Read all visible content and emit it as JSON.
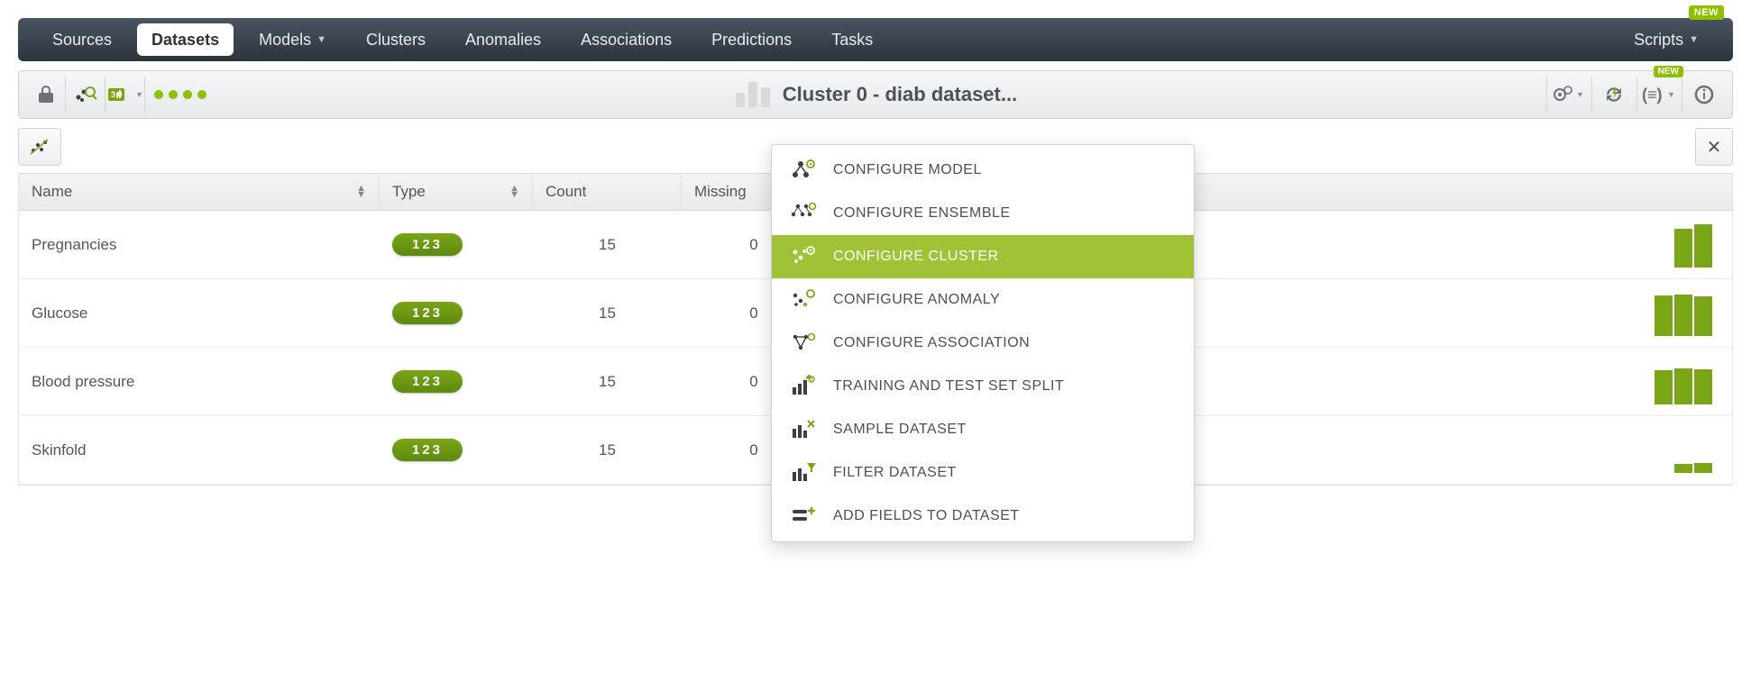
{
  "topnav": {
    "items": [
      {
        "label": "Sources",
        "active": false
      },
      {
        "label": "Datasets",
        "active": true
      },
      {
        "label": "Models",
        "active": false,
        "dropdown": true
      },
      {
        "label": "Clusters",
        "active": false
      },
      {
        "label": "Anomalies",
        "active": false
      },
      {
        "label": "Associations",
        "active": false
      },
      {
        "label": "Predictions",
        "active": false
      },
      {
        "label": "Tasks",
        "active": false
      }
    ],
    "scripts_label": "Scripts",
    "new_label": "NEW"
  },
  "subtoolbar": {
    "title": "Cluster 0 - diab dataset...",
    "new_label": "NEW"
  },
  "columns": {
    "name": "Name",
    "type": "Type",
    "count": "Count",
    "missing": "Missing"
  },
  "rows": [
    {
      "name": "Pregnancies",
      "type": "123",
      "count": "15",
      "missing": "0",
      "hist": [
        85,
        95
      ]
    },
    {
      "name": "Glucose",
      "type": "123",
      "count": "15",
      "missing": "0",
      "hist": [
        90,
        92,
        88
      ]
    },
    {
      "name": "Blood pressure",
      "type": "123",
      "count": "15",
      "missing": "0",
      "hist": [
        75,
        80,
        78
      ]
    },
    {
      "name": "Skinfold",
      "type": "123",
      "count": "15",
      "missing": "0",
      "hist": [
        20,
        22
      ]
    }
  ],
  "dropdown": {
    "items": [
      {
        "label": "CONFIGURE MODEL",
        "icon": "model"
      },
      {
        "label": "CONFIGURE ENSEMBLE",
        "icon": "ensemble"
      },
      {
        "label": "CONFIGURE CLUSTER",
        "icon": "cluster",
        "active": true
      },
      {
        "label": "CONFIGURE ANOMALY",
        "icon": "anomaly"
      },
      {
        "label": "CONFIGURE ASSOCIATION",
        "icon": "association"
      },
      {
        "label": "TRAINING AND TEST SET SPLIT",
        "icon": "split"
      },
      {
        "label": "SAMPLE DATASET",
        "icon": "sample"
      },
      {
        "label": "FILTER DATASET",
        "icon": "filter"
      },
      {
        "label": "ADD FIELDS TO DATASET",
        "icon": "addfields"
      }
    ]
  }
}
